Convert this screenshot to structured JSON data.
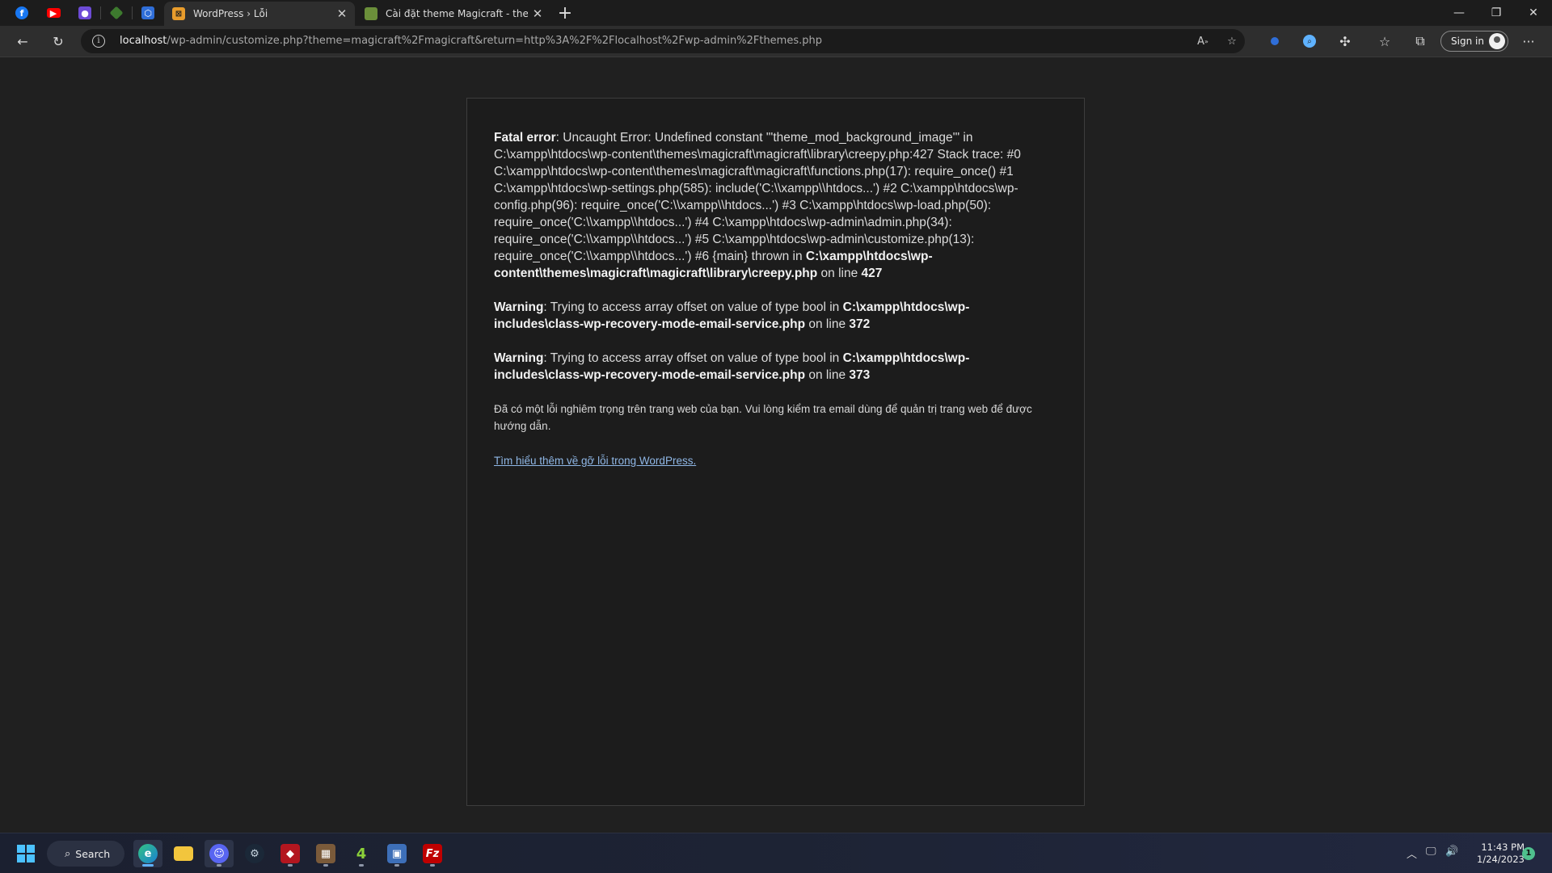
{
  "browser": {
    "tabs": [
      {
        "title": "WordPress › Lỗi",
        "active": true,
        "favicon": "wordpress-error-icon"
      },
      {
        "title": "Cài đặt theme Magicraft - theme",
        "active": false,
        "favicon": "minecraft-block-icon"
      }
    ],
    "pinned_tabs": [
      "facebook-icon",
      "youtube-icon",
      "twitch-icon",
      "minecraft-icon",
      "app-hex-icon"
    ],
    "address": {
      "host": "localhost",
      "path": "/wp-admin/customize.php?theme=magicraft%2Fmagicraft&return=http%3A%2F%2Flocalhost%2Fwp-admin%2Fthemes.php"
    },
    "sign_in_label": "Sign in",
    "accent_color": "#5fb2ff"
  },
  "page": {
    "fatal": {
      "label": "Fatal error",
      "text1": ": Uncaught Error: Undefined constant \"'theme_mod_background_image'\" in C:\\xampp\\htdocs\\wp-content\\themes\\magicraft\\magicraft\\library\\creepy.php:427 Stack trace: #0 C:\\xampp\\htdocs\\wp-content\\themes\\magicraft\\magicraft\\functions.php(17): require_once() #1 C:\\xampp\\htdocs\\wp-settings.php(585): include('C:\\\\xampp\\\\htdocs...') #2 C:\\xampp\\htdocs\\wp-config.php(96): require_once('C:\\\\xampp\\\\htdocs...') #3 C:\\xampp\\htdocs\\wp-load.php(50): require_once('C:\\\\xampp\\\\htdocs...') #4 C:\\xampp\\htdocs\\wp-admin\\admin.php(34): require_once('C:\\\\xampp\\\\htdocs...') #5 C:\\xampp\\htdocs\\wp-admin\\customize.php(13): require_once('C:\\\\xampp\\\\htdocs...') #6 {main} thrown in ",
      "file": "C:\\xampp\\htdocs\\wp-content\\themes\\magicraft\\magicraft\\library\\creepy.php",
      "on_line": " on line ",
      "line": "427"
    },
    "warnings": [
      {
        "label": "Warning",
        "text": ": Trying to access array offset on value of type bool in ",
        "file": "C:\\xampp\\htdocs\\wp-includes\\class-wp-recovery-mode-email-service.php",
        "on_line": " on line ",
        "line": "372"
      },
      {
        "label": "Warning",
        "text": ": Trying to access array offset on value of type bool in ",
        "file": "C:\\xampp\\htdocs\\wp-includes\\class-wp-recovery-mode-email-service.php",
        "on_line": " on line ",
        "line": "373"
      }
    ],
    "notice": "Đã có một lỗi nghiêm trọng trên trang web của bạn. Vui lòng kiểm tra email dùng để quản trị trang web để được hướng dẫn.",
    "doc_link": "Tìm hiểu thêm về gỡ lỗi trong WordPress."
  },
  "taskbar": {
    "search_label": "Search",
    "apps": [
      "edge-icon",
      "file-explorer-icon",
      "discord-icon",
      "steam-icon",
      "game-app-icon",
      "minecraft-icon",
      "left4dead-icon",
      "network-app-icon",
      "filezilla-icon"
    ],
    "time": "11:43 PM",
    "date": "1/24/2023",
    "notification_count": "1"
  }
}
